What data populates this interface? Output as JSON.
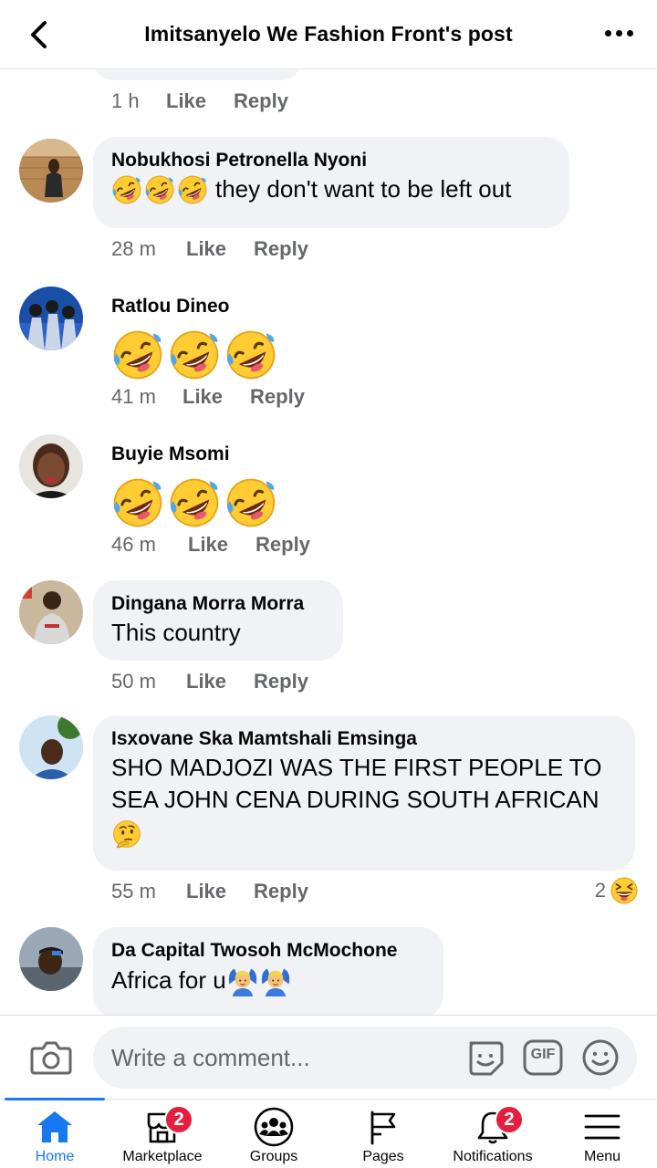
{
  "header": {
    "title": "Imitsanyelo We Fashion Front's post"
  },
  "previous_comment": {
    "time": "1 h",
    "like": "Like",
    "reply": "Reply"
  },
  "comments": [
    {
      "author": "Nobukhosi Petronella Nyoni",
      "text": "they don't want to be left out",
      "emoji_prefix": [
        "rolling-on-floor-laughing",
        "rolling-on-floor-laughing",
        "rolling-on-floor-laughing"
      ],
      "time": "28 m",
      "like": "Like",
      "reply": "Reply"
    },
    {
      "author": "Ratlou Dineo",
      "text": "",
      "big_emoji": [
        "rolling-on-floor-laughing",
        "rolling-on-floor-laughing",
        "rolling-on-floor-laughing"
      ],
      "time": "41 m",
      "like": "Like",
      "reply": "Reply"
    },
    {
      "author": "Buyie Msomi",
      "text": "",
      "big_emoji": [
        "rolling-on-floor-laughing",
        "rolling-on-floor-laughing",
        "rolling-on-floor-laughing"
      ],
      "time": "46 m",
      "like": "Like",
      "reply": "Reply"
    },
    {
      "author": "Dingana Morra Morra",
      "text": "This country",
      "time": "50 m",
      "like": "Like",
      "reply": "Reply"
    },
    {
      "author": "Isxovane Ska Mamtshali Emsinga",
      "text_line1": "SHO MADJOZI WAS THE FIRST PEOPLE TO",
      "text_line2": "SEA JOHN CENA DURING SOUTH AFRICAN",
      "emoji_suffix": "thinking-face",
      "time": "55 m",
      "like": "Like",
      "reply": "Reply",
      "reaction_count": "2",
      "reaction_icon": "laughing-face"
    },
    {
      "author": "Da Capital Twosoh McMochone",
      "text": "Africa for u",
      "emoji_suffix": [
        "person-gesturing-ok",
        "person-gesturing-ok"
      ]
    }
  ],
  "composer": {
    "placeholder": "Write a comment...",
    "gif_label": "GIF"
  },
  "tabbar": {
    "items": [
      {
        "label": "Home",
        "icon": "home-icon",
        "active": true
      },
      {
        "label": "Marketplace",
        "icon": "marketplace-icon",
        "badge": "2"
      },
      {
        "label": "Groups",
        "icon": "groups-icon"
      },
      {
        "label": "Pages",
        "icon": "pages-flag-icon"
      },
      {
        "label": "Notifications",
        "icon": "bell-icon",
        "badge": "2"
      },
      {
        "label": "Menu",
        "icon": "hamburger-menu-icon"
      }
    ]
  },
  "colors": {
    "accent": "#1877f2",
    "bubble": "#f0f2f5",
    "meta": "#65676b",
    "badge": "#e41e3f"
  }
}
